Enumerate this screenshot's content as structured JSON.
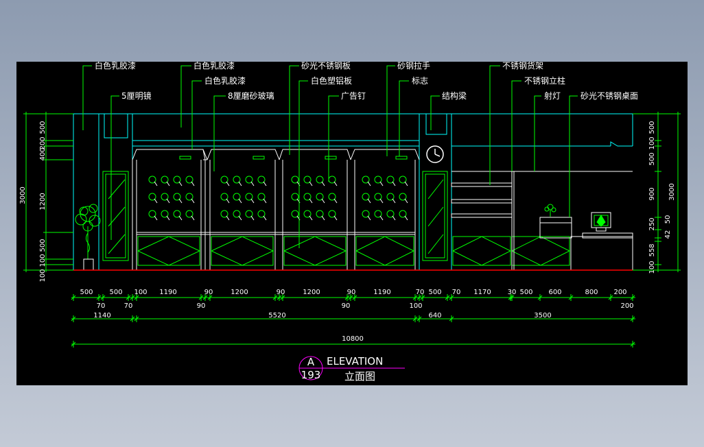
{
  "labels_top": [
    {
      "id": "l1",
      "text": "白色乳胶漆"
    },
    {
      "id": "l2",
      "text": "白色乳胶漆"
    },
    {
      "id": "l3",
      "text": "砂光不锈钢板"
    },
    {
      "id": "l4",
      "text": "砂钢拉手"
    },
    {
      "id": "l5",
      "text": "不锈钢货架"
    },
    {
      "id": "l6",
      "text": "白色乳胶漆"
    },
    {
      "id": "l7",
      "text": "白色塑铝板"
    },
    {
      "id": "l8",
      "text": "标志"
    },
    {
      "id": "l9",
      "text": "不锈钢立柱"
    },
    {
      "id": "l10",
      "text": "5厘明镜"
    },
    {
      "id": "l11",
      "text": "8厘磨砂玻璃"
    },
    {
      "id": "l12",
      "text": "广告钉"
    },
    {
      "id": "l13",
      "text": "结构梁"
    },
    {
      "id": "l14",
      "text": "射灯"
    },
    {
      "id": "l15",
      "text": "砂光不锈钢桌面"
    }
  ],
  "dims_left": {
    "outer": "3000",
    "inner": [
      "500",
      "200",
      "400",
      "1200",
      "500",
      "100",
      "100"
    ]
  },
  "dims_right": {
    "outer": "3000",
    "inner": [
      "500",
      "100",
      "500",
      "900",
      "250",
      "50",
      "42",
      "100",
      "558"
    ]
  },
  "dims_bottom": {
    "row1": [
      "500",
      "70",
      "500",
      "70",
      "100",
      "1190",
      "90",
      "1200",
      "90",
      "1200",
      "90",
      "1190",
      "70",
      "500",
      "70",
      "1170",
      "30",
      "500",
      "600",
      "800",
      "200"
    ],
    "row2": [
      "1140",
      "90",
      "5520",
      "90",
      "100",
      "640",
      "3500",
      "200"
    ],
    "total": "10800"
  },
  "title": {
    "mark_top": "A",
    "mark_bottom": "193",
    "en": "ELEVATION",
    "zh": "立面图"
  },
  "colors": {
    "drawing": "#00ff00",
    "outline": "#00ffff",
    "text": "#ffffff",
    "symbol": "#ff00ff",
    "floor": "#ff0000"
  }
}
